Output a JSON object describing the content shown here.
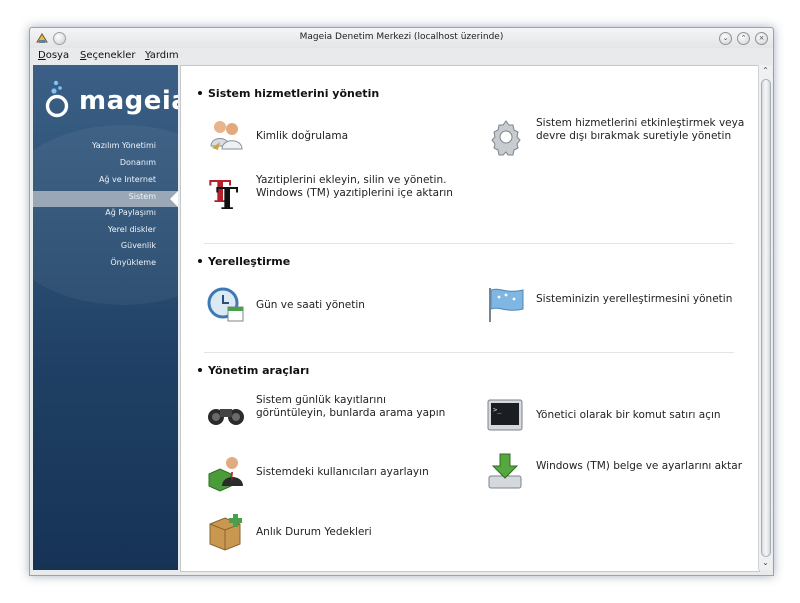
{
  "window": {
    "title": "Mageia Denetim Merkezi  (localhost üzerinde)"
  },
  "menubar": [
    {
      "mnemonic": "D",
      "rest": "osya"
    },
    {
      "mnemonic": "S",
      "rest": "eçenekler"
    },
    {
      "mnemonic": "Y",
      "rest": "ardım"
    }
  ],
  "sidebar": {
    "logo_text": "mageia",
    "items": [
      {
        "label": "Yazılım Yönetimi"
      },
      {
        "label": "Donanım"
      },
      {
        "label": "Ağ ve Internet"
      },
      {
        "label": "Sistem",
        "selected": true
      },
      {
        "label": "Ağ Paylaşımı"
      },
      {
        "label": "Yerel diskler"
      },
      {
        "label": "Güvenlik"
      },
      {
        "label": "Önyükleme"
      }
    ]
  },
  "sections": [
    {
      "title": "Sistem hizmetlerini yönetin",
      "items": [
        {
          "icon": "users-auth-icon",
          "label": "Kimlik doğrulama"
        },
        {
          "icon": "gear-icon",
          "label": "Sistem hizmetlerini etkinleştirmek veya devre dışı bırakmak suretiyle yönetin"
        },
        {
          "icon": "font-icon",
          "label": "Yazıtiplerini ekleyin, silin ve yönetin. Windows (TM) yazıtiplerini içe aktarın"
        }
      ]
    },
    {
      "title": "Yerelleştirme",
      "items": [
        {
          "icon": "clock-calendar-icon",
          "label": "Gün ve saati yönetin"
        },
        {
          "icon": "flag-icon",
          "label": "Sisteminizin yerelleştirmesini yönetin"
        }
      ]
    },
    {
      "title": "Yönetim araçları",
      "items": [
        {
          "icon": "binoculars-icon",
          "label": "Sistem günlük kayıtlarını görüntüleyin, bunlarda arama yapın"
        },
        {
          "icon": "terminal-icon",
          "label": "Yönetici olarak bir komut satırı açın"
        },
        {
          "icon": "user-management-icon",
          "label": "Sistemdeki kullanıcıları ayarlayın"
        },
        {
          "icon": "download-import-icon",
          "label": "Windows (TM) belge ve ayarlarını aktar"
        },
        {
          "icon": "backup-box-icon",
          "label": "Anlık Durum Yedekleri"
        }
      ]
    }
  ],
  "colors": {
    "sidebar_top": "#3b5f86",
    "sidebar_bottom": "#163356",
    "selected": "#9aa7b6"
  }
}
